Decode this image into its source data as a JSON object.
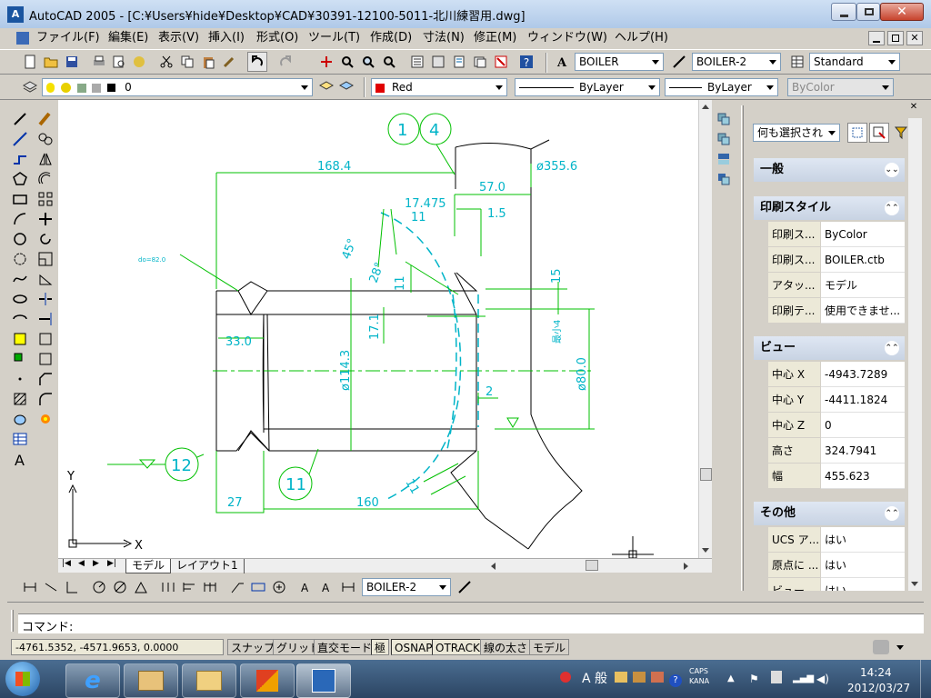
{
  "window": {
    "title": "AutoCAD 2005 - [C:¥Users¥hide¥Desktop¥CAD¥30391-12100-5011-北川練習用.dwg]",
    "app_icon_label": "A"
  },
  "menu": [
    "ファイル(F)",
    "編集(E)",
    "表示(V)",
    "挿入(I)",
    "形式(O)",
    "ツール(T)",
    "作成(D)",
    "寸法(N)",
    "修正(M)",
    "ウィンドウ(W)",
    "ヘルプ(H)"
  ],
  "toolbar_styles": {
    "text_style": "BOILER",
    "dim_style": "BOILER-2",
    "table_style": "Standard"
  },
  "layers": {
    "layer_name": "0",
    "color": "Red",
    "linetype": "ByLayer",
    "lineweight": "ByLayer",
    "plotstyle": "ByColor"
  },
  "drawing": {
    "balloons": [
      "1",
      "4",
      "12",
      "11"
    ],
    "dims": {
      "d168_4": "168.4",
      "d355_6": "ø355.6",
      "d57": "57.0",
      "d17_475": "17.475",
      "d11a": "11",
      "d1_5": "1.5",
      "d45": "45°",
      "d28": "28°",
      "d15": "15",
      "d11b": "11",
      "d17_1": "17.1",
      "d33": "33.0",
      "d114": "ø114.3",
      "d80": "ø80.0",
      "dmin": "最小4",
      "d2": "2",
      "d27": "27",
      "d160": "160",
      "d11c": "11",
      "weld_note": "do=82.0"
    },
    "ucs_x": "X",
    "ucs_y": "Y"
  },
  "layout_tabs": [
    "モデル",
    "レイアウト1"
  ],
  "dim_toolbar": {
    "dim_style": "BOILER-2"
  },
  "properties": {
    "selection": "何も選択され",
    "sections": {
      "general": "一般",
      "plot": "印刷スタイル",
      "view": "ビュー",
      "misc": "その他"
    },
    "plot_rows": [
      {
        "k": "印刷ス...",
        "v": "ByColor"
      },
      {
        "k": "印刷ス...",
        "v": "BOILER.ctb"
      },
      {
        "k": "アタッ...",
        "v": "モデル"
      },
      {
        "k": "印刷テ...",
        "v": "使用できませ..."
      }
    ],
    "view_rows": [
      {
        "k": "中心 X",
        "v": "-4943.7289"
      },
      {
        "k": "中心 Y",
        "v": "-4411.1824"
      },
      {
        "k": "中心 Z",
        "v": "0"
      },
      {
        "k": "高さ",
        "v": "324.7941"
      },
      {
        "k": "幅",
        "v": "455.623"
      }
    ],
    "misc_rows": [
      {
        "k": "UCS ア...",
        "v": "はい"
      },
      {
        "k": "原点に ...",
        "v": "はい"
      },
      {
        "k": "ビュー...",
        "v": "はい"
      }
    ]
  },
  "command": {
    "prompt": "コマンド:"
  },
  "status": {
    "coords": "-4761.5352, -4571.9653, 0.0000",
    "buttons": [
      "スナップ",
      "グリッド",
      "直交モード",
      "極",
      "OSNAP",
      "OTRACK",
      "線の太さ",
      "モデル"
    ]
  },
  "taskbar": {
    "ime": "A 般",
    "caps": "CAPS",
    "kana": "KANA",
    "time": "14:24",
    "date": "2012/03/27"
  },
  "colors": {
    "drawing_green": "#00c000",
    "drawing_cyan": "#00b4c8",
    "accent_red": "#d00000"
  }
}
